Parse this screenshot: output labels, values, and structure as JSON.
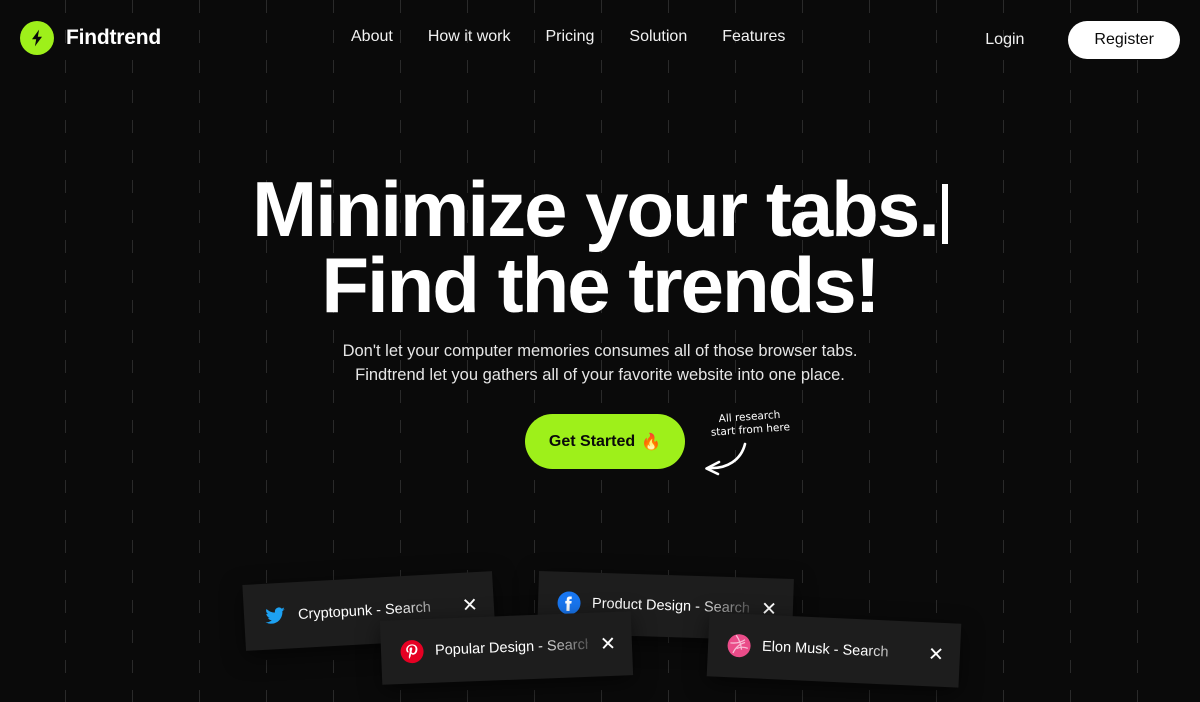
{
  "brand": {
    "name": "Findtrend",
    "logo_icon": "lightning-bolt-icon",
    "logo_color": "#9ef01a"
  },
  "nav": {
    "items": [
      {
        "label": "About"
      },
      {
        "label": "How it work"
      },
      {
        "label": "Pricing"
      },
      {
        "label": "Solution"
      },
      {
        "label": "Features"
      }
    ]
  },
  "auth": {
    "login_label": "Login",
    "register_label": "Register"
  },
  "hero": {
    "headline_line1": "Minimize your tabs.",
    "headline_line2": "Find the trends!",
    "subtitle_line1": "Don't let your computer memories consumes all of those browser tabs.",
    "subtitle_line2": "Findtrend let you gathers all of your favorite website into one place.",
    "cta_label": "Get Started",
    "cta_emoji": "🔥",
    "cta_color": "#9ef01a",
    "annotation_line1": "All research",
    "annotation_line2": "start from here",
    "annotation_icon": "curved-arrow-left-icon"
  },
  "tabs": [
    {
      "id": "cryptopunk",
      "title": "Cryptopunk - Search",
      "icon": "twitter-icon",
      "icon_color": "#1da1f2",
      "close_label": "✕"
    },
    {
      "id": "product",
      "title": "Product Design - Search",
      "icon": "facebook-icon",
      "icon_color": "#1877f2",
      "close_label": "✕"
    },
    {
      "id": "popular",
      "title": "Popular Design - Search",
      "icon": "pinterest-icon",
      "icon_color": "#e60023",
      "close_label": "✕"
    },
    {
      "id": "elon",
      "title": "Elon Musk - Search",
      "icon": "dribbble-icon",
      "icon_color": "#ea4c89",
      "close_label": "✕"
    }
  ],
  "background": {
    "color": "#0a0a0a",
    "grid_line_color": "rgba(255,255,255,0.13)",
    "grid_spacing_px": 67
  }
}
